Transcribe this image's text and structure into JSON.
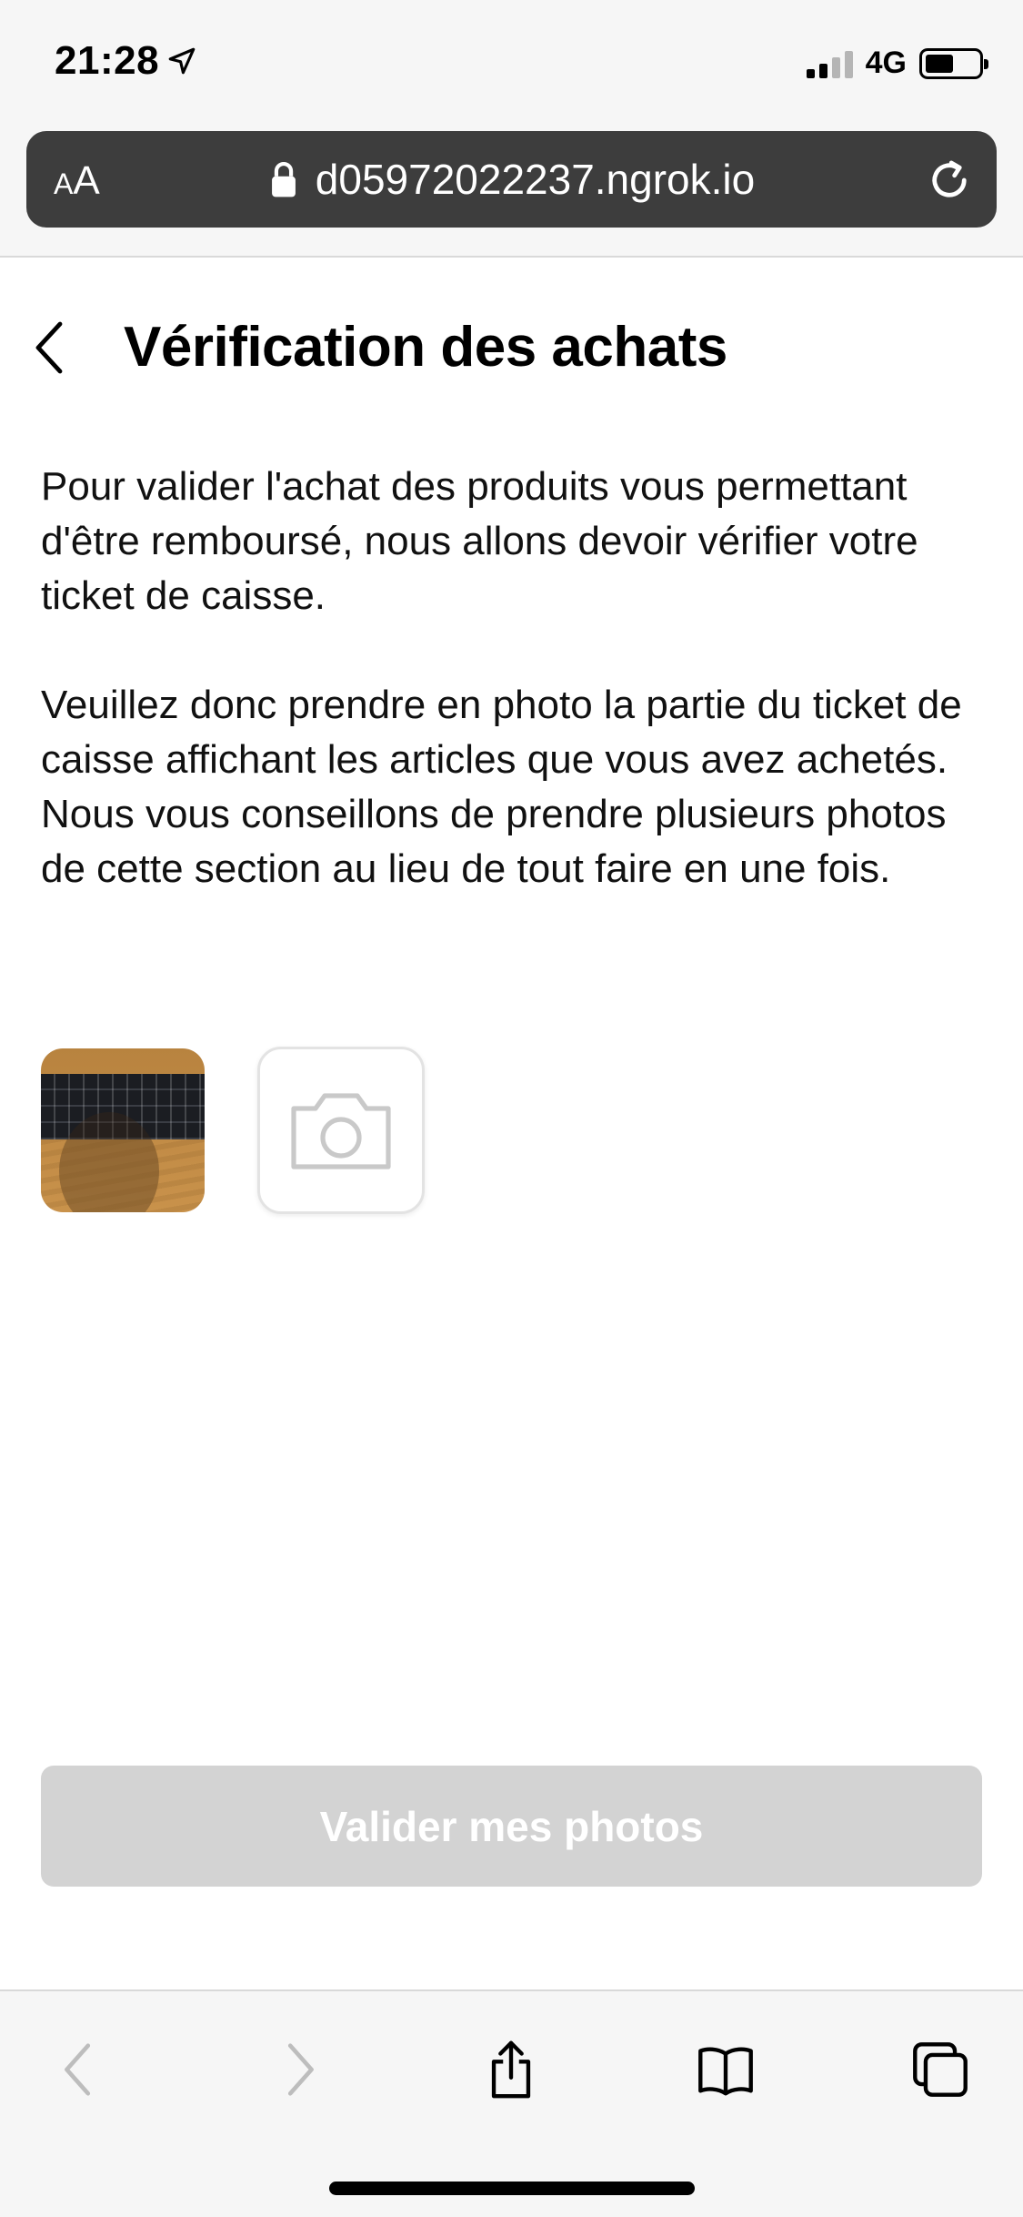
{
  "status_bar": {
    "time": "21:28",
    "network": "4G"
  },
  "browser": {
    "aa_small": "A",
    "aa_large": "A",
    "url": "d05972022237.ngrok.io"
  },
  "page": {
    "title": "Vérification des achats",
    "paragraph1": "Pour valider l'achat des produits vous permettant d'être remboursé, nous allons devoir vérifier votre ticket de caisse.",
    "paragraph2": "Veuillez donc prendre en photo la partie du ticket de caisse affichant les articles que vous avez achetés. Nous vous conseillons de prendre plusieurs photos de cette section au lieu de tout faire en une fois.",
    "validate_button": "Valider mes photos"
  },
  "icons": {
    "location": "location-arrow-icon",
    "lock": "lock-icon",
    "reload": "reload-icon",
    "back": "chevron-left-icon",
    "camera": "camera-icon",
    "toolbar_back": "chevron-left-icon",
    "toolbar_forward": "chevron-right-icon",
    "share": "share-icon",
    "bookmarks": "book-icon",
    "tabs": "tabs-icon"
  },
  "colors": {
    "button_disabled": "#d3d3d3",
    "urlbar": "#3d3d3d"
  }
}
